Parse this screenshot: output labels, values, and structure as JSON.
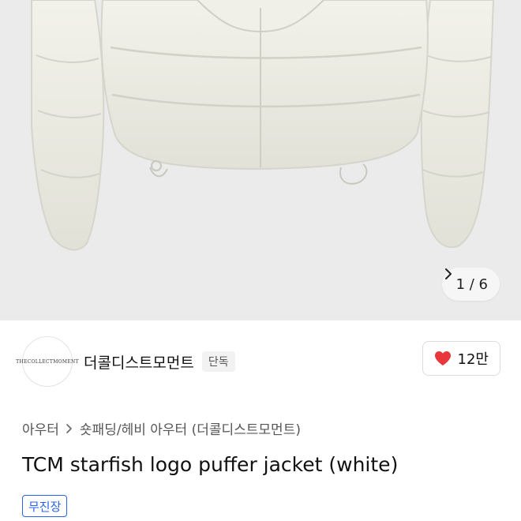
{
  "gallery": {
    "pager_text": "1 / 6"
  },
  "store": {
    "logo_text": "THECOLLECTMOMENT",
    "name": "더콜디스트모먼트",
    "badge": "단독"
  },
  "like": {
    "count": "12만",
    "color": "#e8363b"
  },
  "breadcrumb": {
    "level1": "아우터",
    "level2": "숏패딩/헤비 아우터 (더콜디스트모먼트)"
  },
  "product": {
    "title": "TCM starfish logo puffer jacket (white)",
    "tag": "무진장"
  },
  "colors": {
    "accent_blue": "#2a63f0",
    "hero_bg": "#ebebeb",
    "jacket": "#efeee6"
  }
}
